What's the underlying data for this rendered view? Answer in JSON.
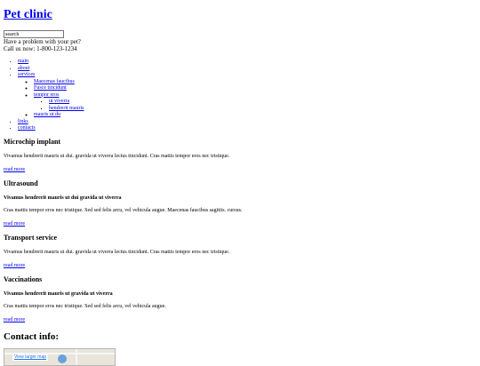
{
  "site": {
    "title": "Pet clinic"
  },
  "search": {
    "value": "search",
    "placeholder": ""
  },
  "header": {
    "tagline": "Have a problem with your pet?",
    "phone": "Call us now: 1-800-123-1234"
  },
  "nav": {
    "items": [
      {
        "label": "main"
      },
      {
        "label": "about"
      },
      {
        "label": "services"
      },
      {
        "label": "links"
      },
      {
        "label": "contacts"
      }
    ],
    "services_sub": [
      {
        "label": "Maecenas faucibus"
      },
      {
        "label": "Fusce tincidunt"
      },
      {
        "label": "tempor eros"
      },
      {
        "label": "mauris ut du"
      }
    ],
    "tempor_sub": [
      {
        "label": "ut viverra"
      },
      {
        "label": "hendrerit mauris"
      }
    ]
  },
  "services": [
    {
      "title": "Microchip implant",
      "subtitle": "",
      "text": "Vivamus hendrerit mauris ut dui. gravida ut viverra lectus tincidunt. Cras mattis tempor eros nec tristique.",
      "link": "read more"
    },
    {
      "title": "Ultrasound",
      "subtitle": "Vivamus hendrerit mauris ut dui gravida ut viverra",
      "text": "Cras mattis tempor eros nec tristique. Sed sed felis arcu, vel vehicula augue. Maecenas faucibus sagittis. cursus.",
      "link": "read more"
    },
    {
      "title": "Transport service",
      "subtitle": "",
      "text": "Vivamus hendrerit mauris ut dui. gravida ut viverra lectus tincidunt. Cras mattis tempor eros nec tristique.",
      "link": "read more"
    },
    {
      "title": "Vaccinations",
      "subtitle": "Vivamus hendrerit mauris ut gravida ut viverra",
      "text": "Cras mattis tempor eros nec tristique. Sed sed felis arcu, vel vehicula augue.",
      "link": "read more"
    }
  ],
  "contact": {
    "title": "Contact info:",
    "map_link": "View larger map"
  }
}
